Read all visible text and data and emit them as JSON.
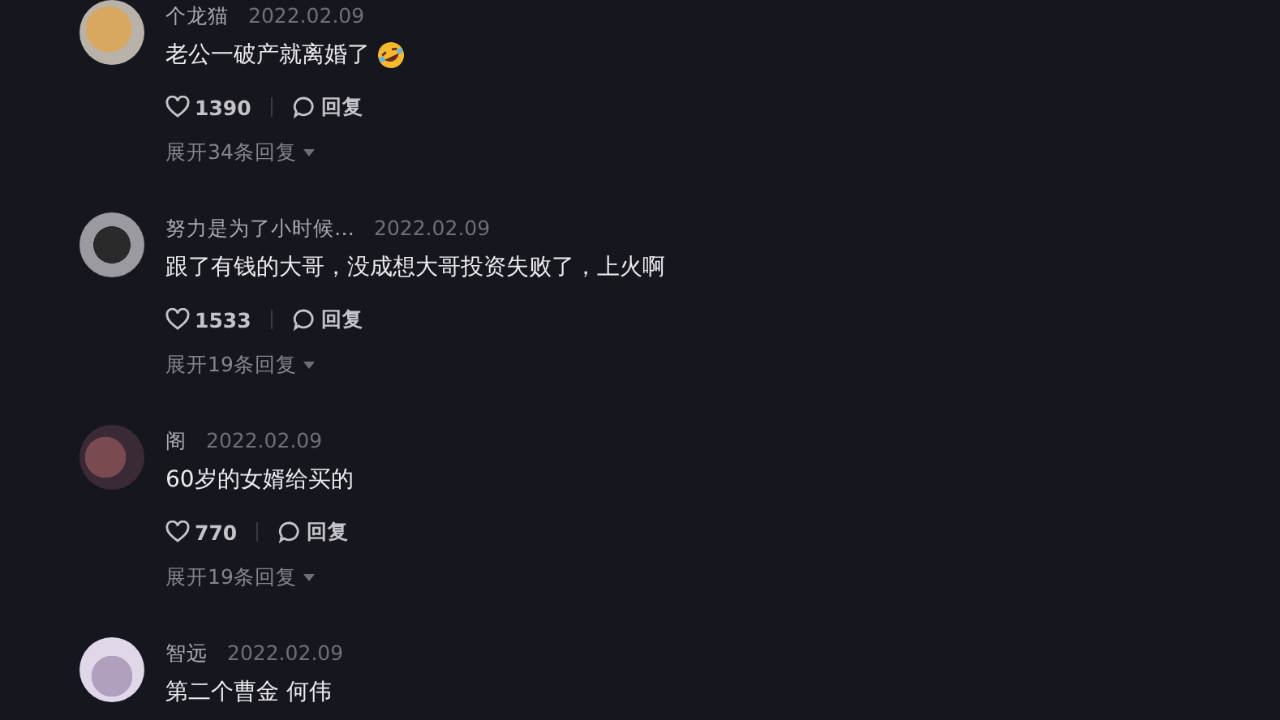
{
  "comments": [
    {
      "username": "个龙猫",
      "date": "2022.02.09",
      "text": "老公一破产就离婚了",
      "trailing_emoji": true,
      "likes": "1390",
      "reply": "回复",
      "expand": "展开34条回复"
    },
    {
      "username": "努力是为了小时候…",
      "date": "2022.02.09",
      "text": "跟了有钱的大哥，没成想大哥投资失败了，上火啊",
      "trailing_emoji": false,
      "likes": "1533",
      "reply": "回复",
      "expand": "展开19条回复"
    },
    {
      "username": "阁",
      "date": "2022.02.09",
      "text": "60岁的女婿给买的",
      "trailing_emoji": false,
      "likes": "770",
      "reply": "回复",
      "expand": "展开19条回复"
    },
    {
      "username": "智远",
      "date": "2022.02.09",
      "text": "第二个曹金 何伟",
      "trailing_emoji": false
    }
  ]
}
